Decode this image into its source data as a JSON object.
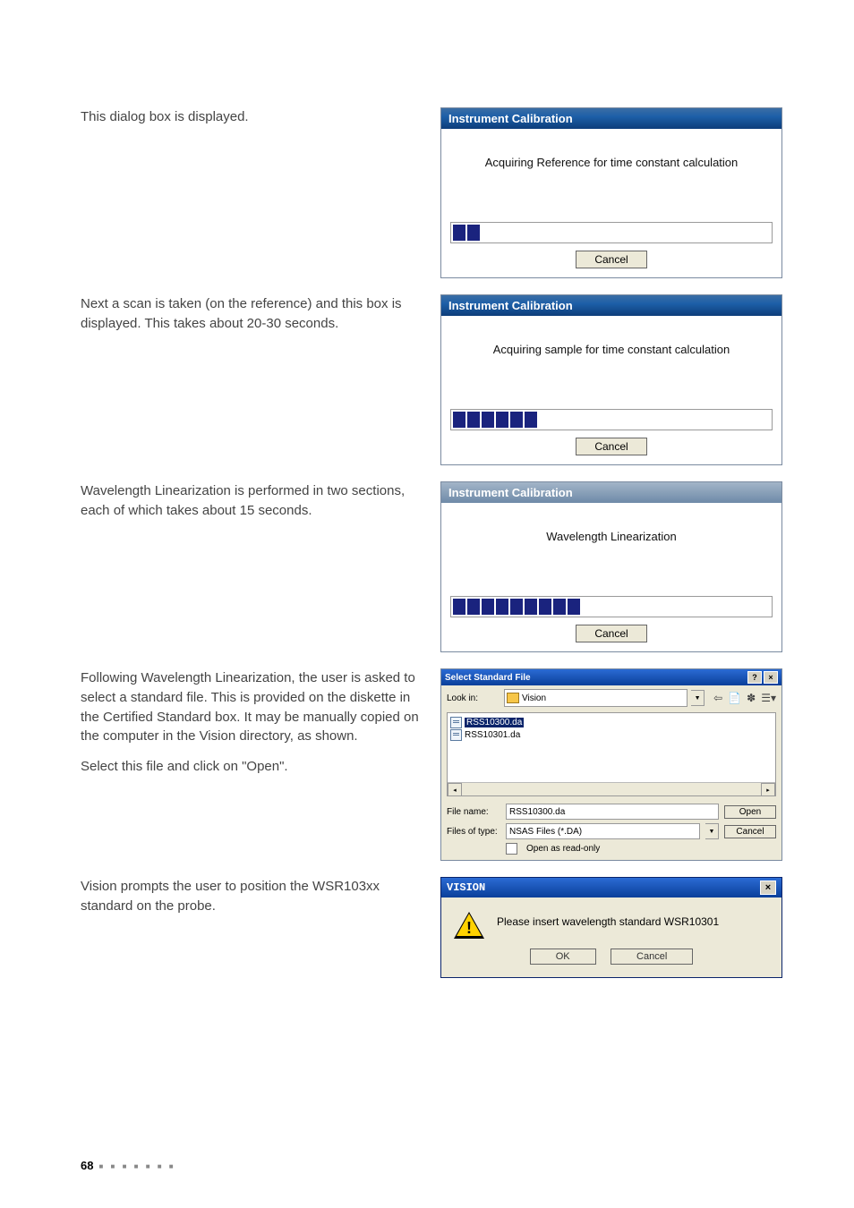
{
  "intro": "This dialog box is displayed.",
  "dlg1": {
    "title": "Instrument Calibration",
    "msg": "Acquiring Reference for time constant calculation",
    "segments": 2,
    "cancel": "Cancel"
  },
  "p2": "Next a scan is taken (on the reference) and this box is displayed. This takes about 20-30 seconds.",
  "dlg2": {
    "title": "Instrument Calibration",
    "msg": "Acquiring sample for time constant calculation",
    "segments": 6,
    "cancel": "Cancel"
  },
  "p3": "Wavelength Linearization is performed in two sections, each of which takes about 15 seconds.",
  "dlg3": {
    "title": "Instrument Calibration",
    "msg": "Wavelength Linearization",
    "segments": 9,
    "cancel": "Cancel"
  },
  "p4a": "Following Wavelength Linearization, the user is asked to select a standard file. This is provided on the diskette in the Certified Standard box. It may be manually copied on the computer in the Vision directory, as shown.",
  "p4b": "Select this file and click on \"Open\".",
  "filedlg": {
    "title": "Select Standard File",
    "lookin_lbl": "Look in:",
    "lookin_val": "Vision",
    "files": [
      "RSS10300.da",
      "RSS10301.da"
    ],
    "filename_lbl": "File name:",
    "filename_val": "RSS10300.da",
    "filetype_lbl": "Files of type:",
    "filetype_val": "NSAS Files (*.DA)",
    "readonly_lbl": "Open as read-only",
    "open": "Open",
    "cancel": "Cancel"
  },
  "p5": "Vision prompts the user to position the WSR103xx standard on the probe.",
  "vision": {
    "title": "VISION",
    "msg": "Please insert wavelength standard WSR10301",
    "ok": "OK",
    "cancel": "Cancel"
  },
  "pagenum": "68"
}
